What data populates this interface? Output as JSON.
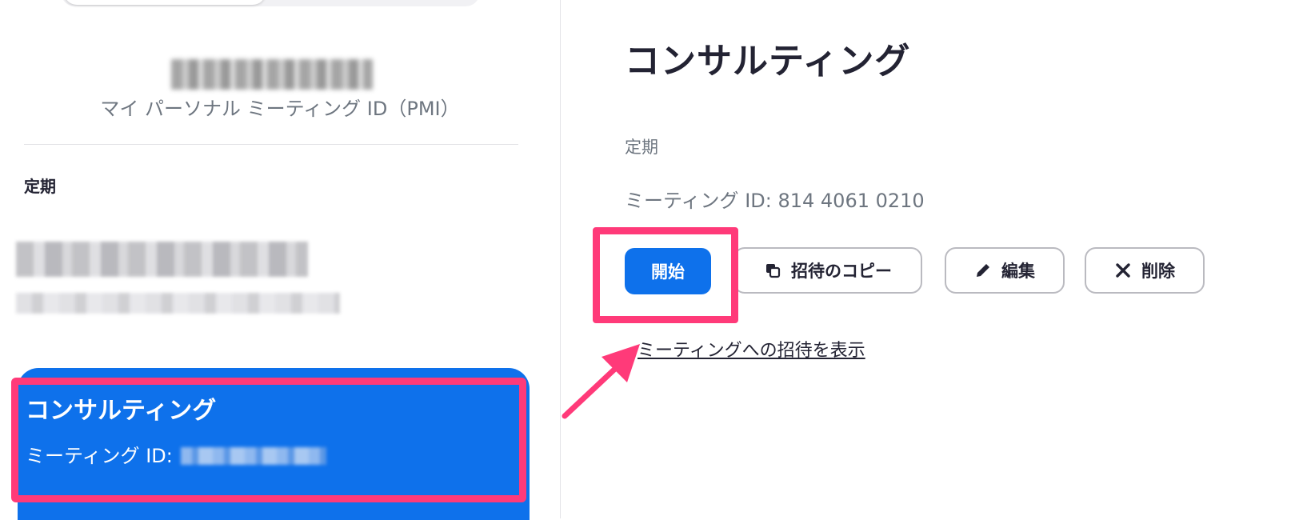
{
  "sidebar": {
    "pmi_label": "マイ パーソナル ミーティング ID（PMI）",
    "section_title": "定期",
    "selected_meeting": {
      "title": "コンサルティング",
      "id_label": "ミーティング ID:"
    }
  },
  "detail": {
    "title": "コンサルティング",
    "recurring_label": "定期",
    "meeting_id": "ミーティング ID: 814 4061 0210",
    "buttons": {
      "start": "開始",
      "copy_invite": "招待のコピー",
      "edit": "編集",
      "delete": "削除"
    },
    "invite_link": "ミーティングへの招待を表示"
  },
  "colors": {
    "accent": "#0e71eb",
    "highlight": "#ff3a79"
  },
  "icons": {
    "copy": "copy-icon",
    "edit": "pencil-icon",
    "delete": "close-icon"
  }
}
